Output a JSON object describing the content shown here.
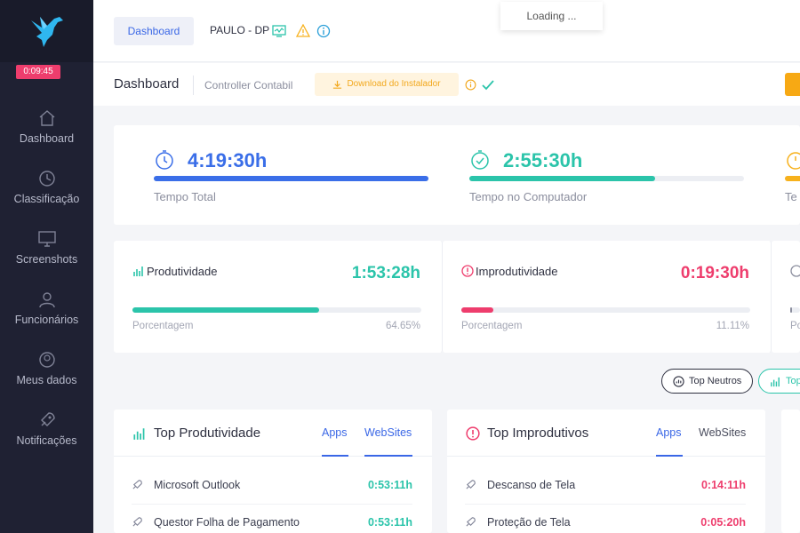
{
  "sidebar": {
    "timer": "0:09:45",
    "items": [
      {
        "label": "Dashboard"
      },
      {
        "label": "Classificação"
      },
      {
        "label": "Screenshots"
      },
      {
        "label": "Funcionários"
      },
      {
        "label": "Meus dados"
      },
      {
        "label": "Notificações"
      }
    ]
  },
  "topbar": {
    "tab_label": "Dashboard",
    "user": "PAULO - DP",
    "loading": "Loading ..."
  },
  "subheader": {
    "title": "Dashboard",
    "link": "Controller Contabil",
    "download": "Download do Instalador"
  },
  "time_summary": [
    {
      "value": "4:19:30h",
      "label": "Tempo Total",
      "progress": 1.0,
      "color": "#3a6ee8"
    },
    {
      "value": "2:55:30h",
      "label": "Tempo no Computador",
      "progress": 0.675,
      "color": "#2bc4aa"
    },
    {
      "value": "",
      "label": "Te",
      "progress": 0.4,
      "color": "#f7b11c"
    }
  ],
  "metrics": [
    {
      "title": "Produtividade",
      "value": "1:53:28h",
      "footer": "Porcentagem",
      "percent": "64.65%",
      "progress": 0.6465,
      "color": "#2bc4aa"
    },
    {
      "title": "Improdutividade",
      "value": "0:19:30h",
      "footer": "Porcentagem",
      "percent": "11.11%",
      "progress": 0.1111,
      "color": "#ee3d6d"
    },
    {
      "footer": "Po",
      "progress": 0.2,
      "color": "#8b8e9e"
    }
  ],
  "pills": {
    "neutral": "Top Neutros",
    "productive": "Top"
  },
  "lists": [
    {
      "title": "Top Produtividade",
      "tabs": [
        "Apps",
        "WebSites"
      ],
      "color": "#2bc4aa",
      "rows": [
        {
          "label": "Microsoft Outlook",
          "time": "0:53:11h"
        },
        {
          "label": "Questor Folha de Pagamento",
          "time": "0:53:11h"
        }
      ]
    },
    {
      "title": "Top Improdutivos",
      "tabs": [
        "Apps",
        "WebSites"
      ],
      "color": "#ee3d6d",
      "rows": [
        {
          "label": "Descanso de Tela",
          "time": "0:14:11h"
        },
        {
          "label": "Proteção de Tela",
          "time": "0:05:20h"
        }
      ]
    }
  ]
}
